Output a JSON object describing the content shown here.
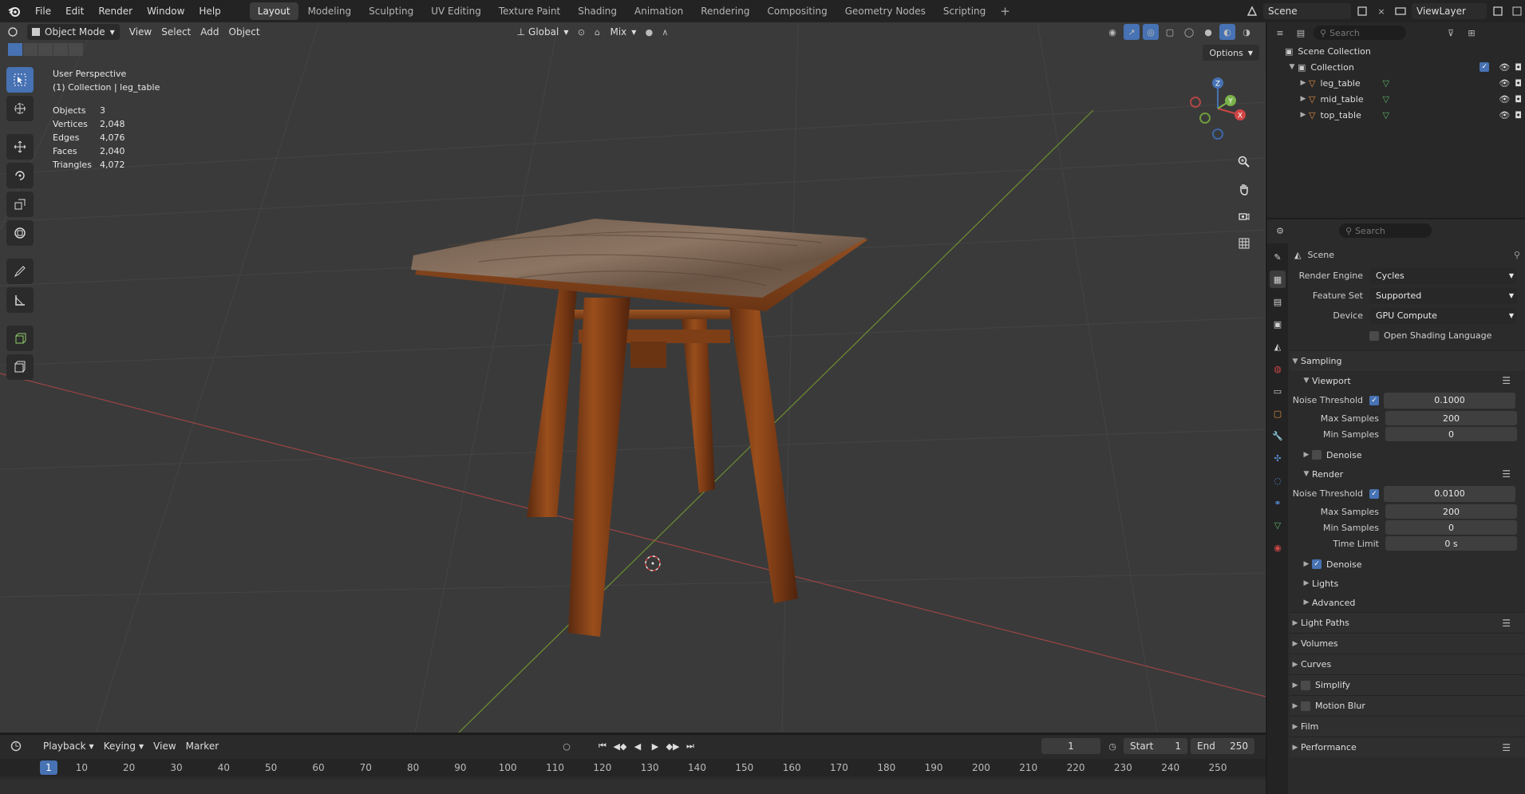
{
  "topbar": {
    "menus": [
      "File",
      "Edit",
      "Render",
      "Window",
      "Help"
    ],
    "workspaces": [
      "Layout",
      "Modeling",
      "Sculpting",
      "UV Editing",
      "Texture Paint",
      "Shading",
      "Animation",
      "Rendering",
      "Compositing",
      "Geometry Nodes",
      "Scripting"
    ],
    "active_workspace": "Layout",
    "add_label": "+",
    "scene": "Scene",
    "view_layer": "ViewLayer"
  },
  "viewport": {
    "mode": "Object Mode",
    "menus": [
      "View",
      "Select",
      "Add",
      "Object"
    ],
    "orientation": "Global",
    "snap_mode": "Mix",
    "options_label": "Options",
    "perspective": "User Perspective",
    "collection_info": "(1) Collection | leg_table",
    "stats": [
      {
        "label": "Objects",
        "value": "3"
      },
      {
        "label": "Vertices",
        "value": "2,048"
      },
      {
        "label": "Edges",
        "value": "4,076"
      },
      {
        "label": "Faces",
        "value": "2,040"
      },
      {
        "label": "Triangles",
        "value": "4,072"
      }
    ],
    "gizmo_axes": {
      "x": "X",
      "y": "Y",
      "z": "Z"
    }
  },
  "outliner": {
    "search_placeholder": "Search",
    "scene_collection": "Scene Collection",
    "collection": "Collection",
    "objects": [
      "leg_table",
      "mid_table",
      "top_table"
    ]
  },
  "properties": {
    "search_placeholder": "Search",
    "context": "Scene",
    "render_engine_label": "Render Engine",
    "render_engine": "Cycles",
    "feature_set_label": "Feature Set",
    "feature_set": "Supported",
    "device_label": "Device",
    "device": "GPU Compute",
    "osl_label": "Open Shading Language",
    "sampling": "Sampling",
    "viewport": "Viewport",
    "render": "Render",
    "noise_threshold_label": "Noise Threshold",
    "max_samples_label": "Max Samples",
    "min_samples_label": "Min Samples",
    "time_limit_label": "Time Limit",
    "denoise_label": "Denoise",
    "vp_noise_threshold": "0.1000",
    "vp_max_samples": "200",
    "vp_min_samples": "0",
    "r_noise_threshold": "0.0100",
    "r_max_samples": "200",
    "r_min_samples": "0",
    "r_time_limit": "0 s",
    "lights": "Lights",
    "advanced": "Advanced",
    "panels": [
      "Light Paths",
      "Volumes",
      "Curves",
      "Simplify",
      "Motion Blur",
      "Film",
      "Performance"
    ]
  },
  "timeline": {
    "menus": [
      "Playback",
      "Keying",
      "View",
      "Marker"
    ],
    "current_frame": "1",
    "start_label": "Start",
    "start": "1",
    "end_label": "End",
    "end": "250",
    "ruler": [
      "1",
      "10",
      "20",
      "30",
      "40",
      "50",
      "60",
      "70",
      "80",
      "90",
      "100",
      "110",
      "120",
      "130",
      "140",
      "150",
      "160",
      "170",
      "180",
      "190",
      "200",
      "210",
      "220",
      "230",
      "240",
      "250"
    ]
  },
  "colors": {
    "accent": "#4772b3",
    "x_axis": "#b84a4a",
    "y_axis": "#7a9c34",
    "wood": "#8a4418"
  }
}
